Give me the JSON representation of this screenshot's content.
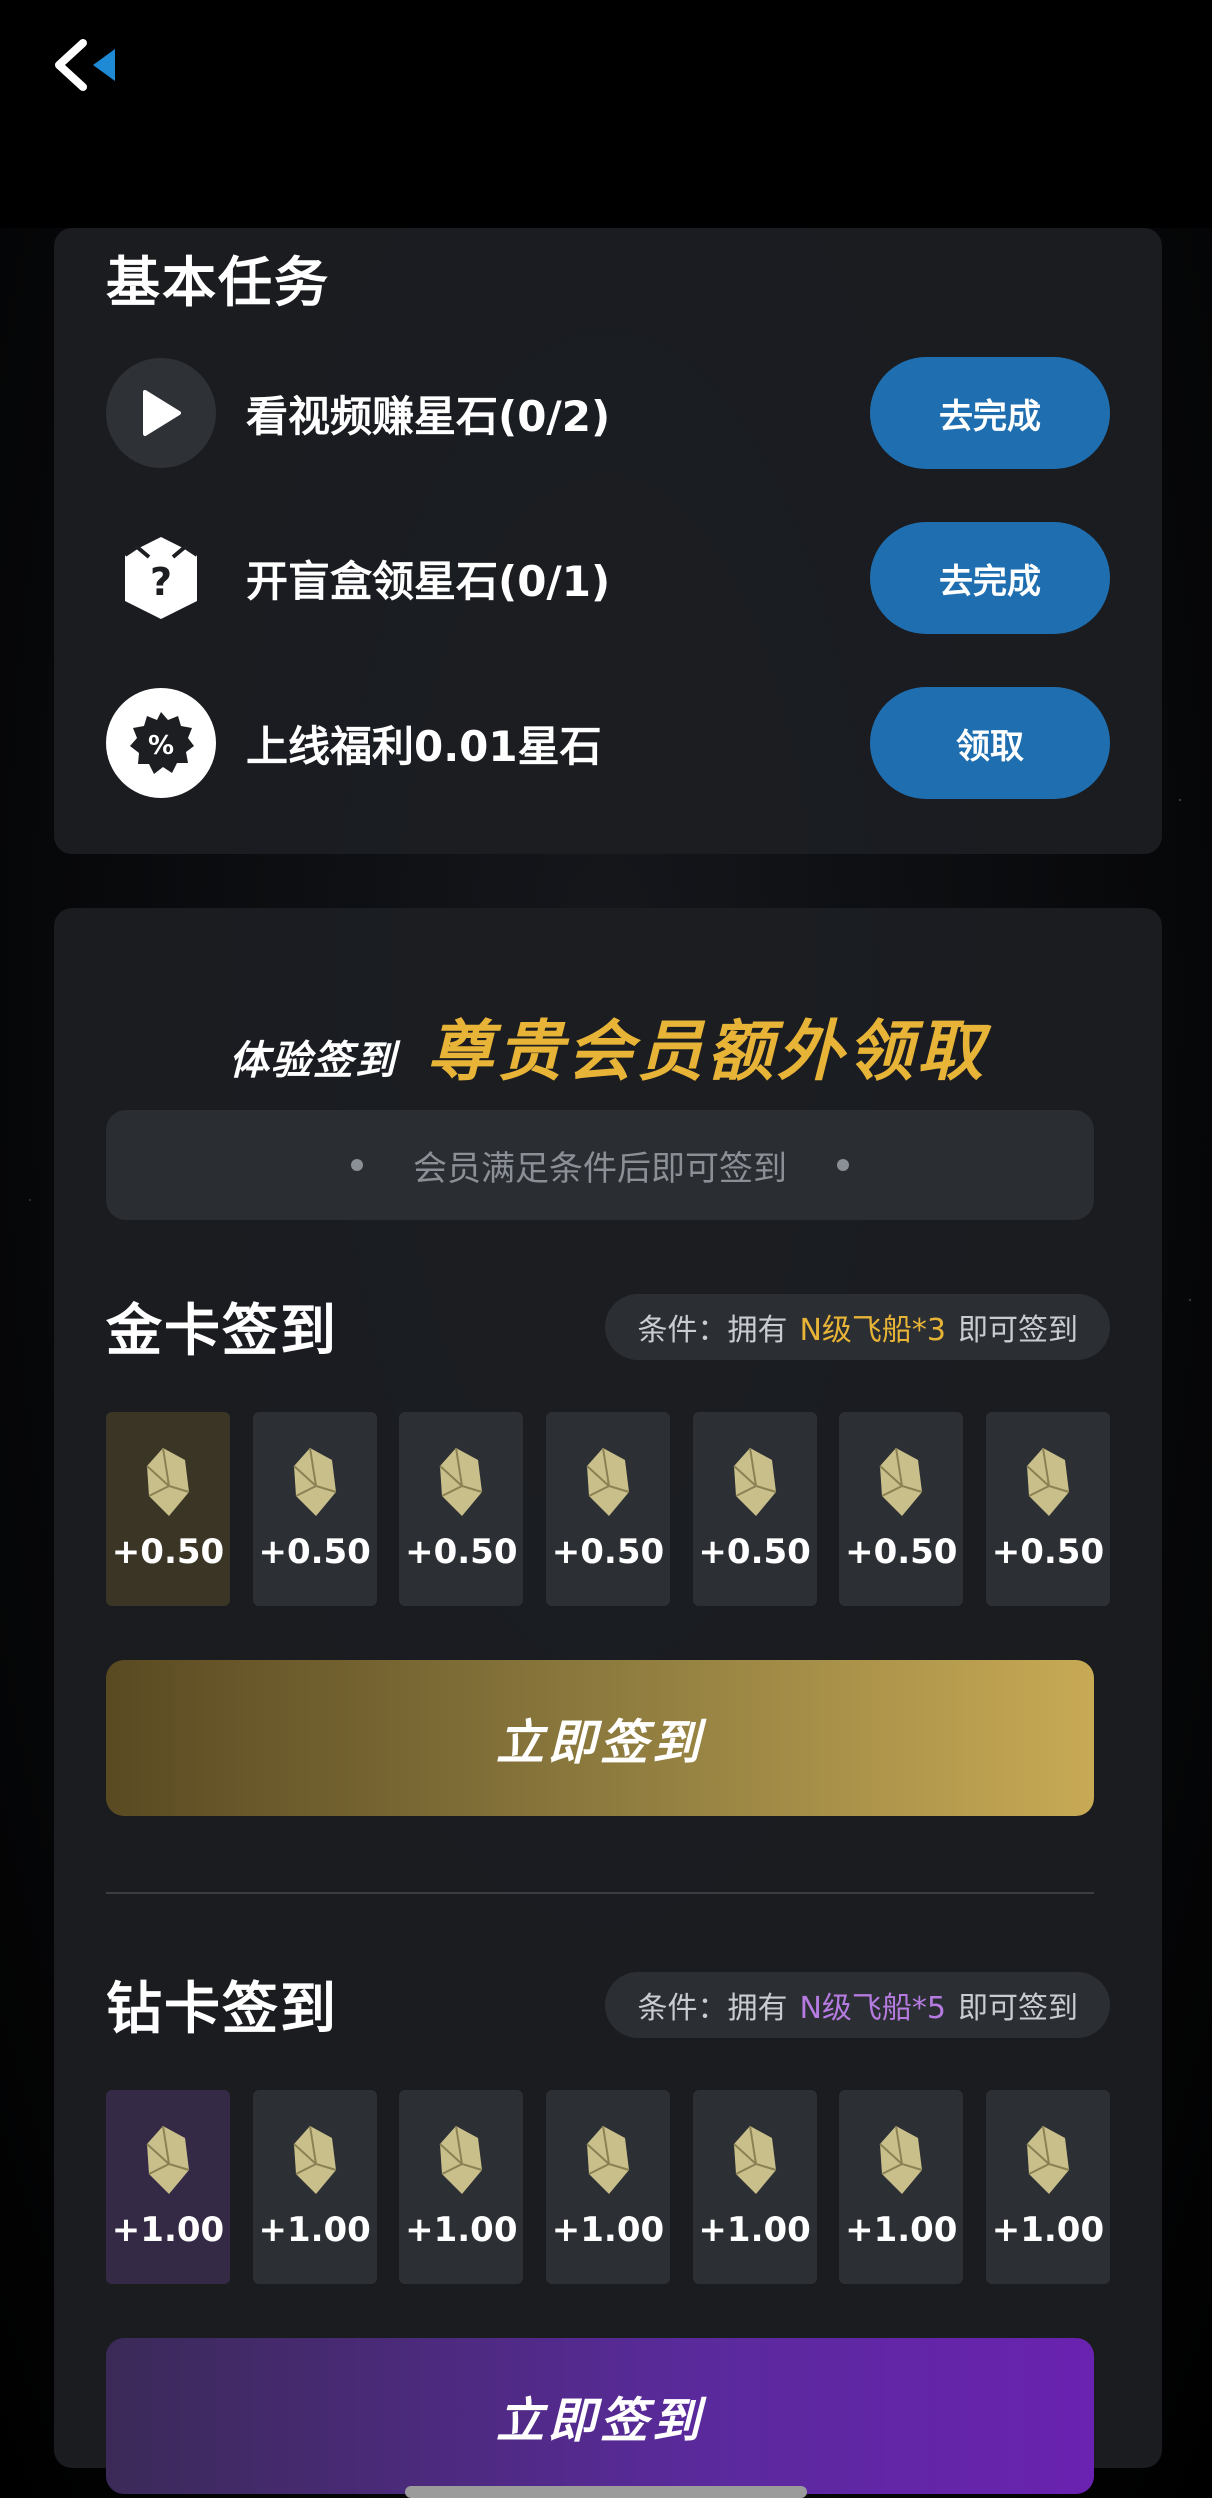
{
  "tasks": {
    "title": "基本任务",
    "items": [
      {
        "label": "看视频赚星石(0/2)",
        "button": "去完成",
        "icon": "play-icon"
      },
      {
        "label": "开盲盒领星石(0/1)",
        "button": "去完成",
        "icon": "mystery-box-icon"
      },
      {
        "label": "上线福利0.01星石",
        "button": "领取",
        "icon": "discount-badge-icon"
      }
    ]
  },
  "checkin": {
    "promo_left": "体验签到",
    "promo_right": "尊贵会员额外领取",
    "notice": "会员满足条件后即可签到",
    "gold": {
      "title": "金卡签到",
      "cond_prefix": "条件：拥有",
      "cond_highlight": "N级飞船*3",
      "cond_suffix": "即可签到",
      "rewards": [
        "+0.50",
        "+0.50",
        "+0.50",
        "+0.50",
        "+0.50",
        "+0.50",
        "+0.50"
      ],
      "button": "立即签到",
      "accent": "#e7b437"
    },
    "diamond": {
      "title": "钻卡签到",
      "cond_prefix": "条件：拥有",
      "cond_highlight": "N级飞船*5",
      "cond_suffix": "即可签到",
      "rewards": [
        "+1.00",
        "+1.00",
        "+1.00",
        "+1.00",
        "+1.00",
        "+1.00",
        "+1.00"
      ],
      "button": "立即签到",
      "accent": "#b57be0"
    }
  }
}
